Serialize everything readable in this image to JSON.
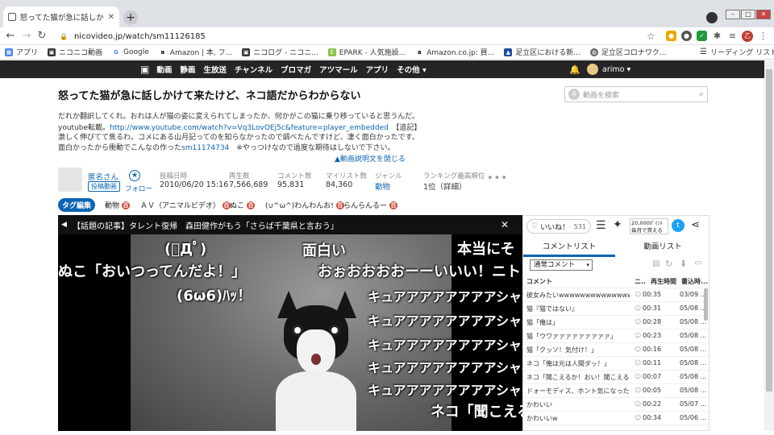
{
  "browser": {
    "tab_title": "怒ってた猫が急に話しかけて来た",
    "url": "nicovideo.jp/watch/sm11126185",
    "profile_label": "乙人"
  },
  "bookmarks": [
    {
      "label": "アプリ",
      "icon": "apps-grid-icon"
    },
    {
      "label": "ニコニコ動画",
      "icon": "niconico-icon"
    },
    {
      "label": "Google",
      "icon": "google-icon"
    },
    {
      "label": "Amazon | 本, フ...",
      "icon": "amazon-icon"
    },
    {
      "label": "ニコログ - ニコニ...",
      "icon": "niconico-icon"
    },
    {
      "label": "EPARK - 人気施設...",
      "icon": "epark-icon"
    },
    {
      "label": "Amazon.co.jp: 買...",
      "icon": "amazon-icon"
    },
    {
      "label": "足立区における新...",
      "icon": "adachi-icon"
    },
    {
      "label": "足立区コロナワク...",
      "icon": "globe-icon"
    },
    {
      "label": "リーディング リスト",
      "icon": "reading-list-icon"
    }
  ],
  "site_nav": [
    "動画",
    "静画",
    "生放送",
    "チャンネル",
    "ブロマガ",
    "アツマール",
    "アプリ",
    "その他 ▾"
  ],
  "user": {
    "name": "arimo ▾"
  },
  "search": {
    "placeholder": "動画を検索"
  },
  "video": {
    "title": "怒ってた猫が急に話しかけて来たけど、ネコ語だからわからない",
    "desc_line1": "だれか翻訳してくれ。おれは人が猫の姿に変えられてしまったか、何かがこの猫に乗り移っていると思うんだ。",
    "desc_line2_prefix": "youtube転載。",
    "desc_line2_link": "http://www.youtube.com/watch?v=Vq3LovOEj5c&feature=player_embedded",
    "desc_line2_suffix": "【追記】",
    "desc_line3": "激しく伸びてて焦るわ。コメにある山月記ってのを知らなかったので調べたんですけど、凄く面白かったです。",
    "desc_line4_prefix": "面白かったから衝動でこんなの作った",
    "desc_line4_link": "sm11174734",
    "desc_line4_suffix": "　※やっつけなので過度な期待はしないで下さい。",
    "collapse": "▲動画説明文を閉じる"
  },
  "uploader": {
    "name": "匿名さん",
    "badge": "投稿動画",
    "follow": "フォロー"
  },
  "stats": [
    {
      "label": "投稿日時",
      "value": "2010/06/20 15:16"
    },
    {
      "label": "再生数",
      "value": "7,566,689"
    },
    {
      "label": "コメント数",
      "value": "95,831"
    },
    {
      "label": "マイリスト数",
      "value": "84,360"
    },
    {
      "label": "ジャンル",
      "value": "動物"
    },
    {
      "label": "ランキング最高順位",
      "value": "1位（詳細）"
    }
  ],
  "tags": {
    "edit": "タグ編集",
    "items": [
      "動物",
      "ＡＶ（アニマルビデオ）",
      "ぬこ",
      "(∪^ω^)わんわんお!",
      "らんらんるー"
    ]
  },
  "player": {
    "news": "【話題の記事】タレント復帰　森田健作がもう「さらば千葉県と言おう」",
    "comments": [
      "(ﾟДﾟ)",
      "面白い",
      "本当にそ",
      "ぬこ「おいつってんだよ！」",
      "おぉおおおおーーいいい！ニト",
      "(6ω6)ﾊｯ！",
      "キュアアアアアアアアシャベ",
      "キュアアアアアアアアシャベ",
      "キュアアアアアアアアシャベ",
      "キュアアアアアアアアシャベ",
      "キュアアアアアアアアシャベ",
      "ネコ「聞こえる"
    ]
  },
  "panel": {
    "like_label": "いいね！",
    "like_count": "531",
    "ad_text": "20,000ﾎﾟｲﾝﾄ 毎月で貰える",
    "tab_comments": "コメントリスト",
    "tab_videos": "動画リスト",
    "comment_select": "通常コメント",
    "headers": [
      "コメント",
      "ニ..",
      "再生時間",
      "書込時..."
    ],
    "rows": [
      {
        "text": "彼女みたいwwwwwwwwwwwwwwwwwwwww",
        "time": "00:35",
        "date": "03/09 ..."
      },
      {
        "text": "猫『猫ではない』",
        "time": "00:31",
        "date": "05/08 ..."
      },
      {
        "text": "猫「俺は」",
        "time": "00:28",
        "date": "05/08 ..."
      },
      {
        "text": "猫「ウワァァァァァァァァァ」",
        "time": "00:23",
        "date": "05/08 ..."
      },
      {
        "text": "猫「クッソ！気付け！」",
        "time": "00:16",
        "date": "05/08 ..."
      },
      {
        "text": "ネコ「俺は元は人間ダッ！」",
        "time": "00:11",
        "date": "05/08 ..."
      },
      {
        "text": "ネコ「聞こえるか！おい！聞こえるか...",
        "time": "00:07",
        "date": "05/08 ..."
      },
      {
        "text": "ドォーモディス、ホント気になったー",
        "time": "00:05",
        "date": "05/08 ..."
      },
      {
        "text": "かわいい",
        "time": "00:22",
        "date": "05/07 ..."
      },
      {
        "text": "かわいいw",
        "time": "00:34",
        "date": "05/06 ..."
      }
    ]
  }
}
